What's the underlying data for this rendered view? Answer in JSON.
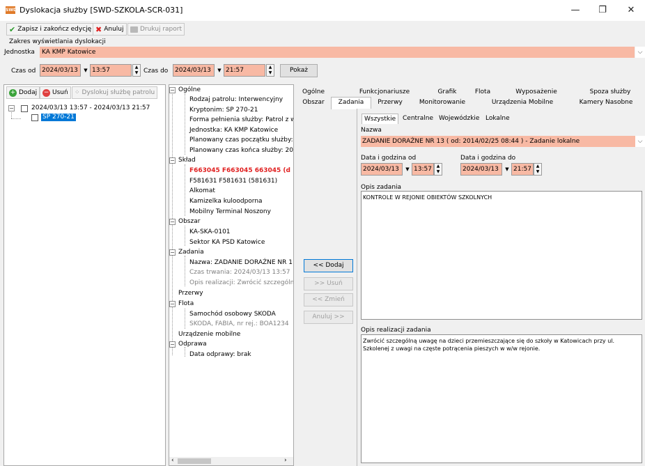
{
  "window": {
    "icon_text": "SWD",
    "title": "Dyslokacja służby [SWD-SZKOLA-SCR-031]",
    "minimize": "—",
    "maximize": "❐",
    "close": "✕"
  },
  "toolbar": {
    "save_label": "Zapisz i zakończ edycję",
    "cancel_label": "Anuluj",
    "print_label": "Drukuj raport"
  },
  "range": {
    "group_label": "Zakres wyświetlania dyslokacji",
    "unit_label": "Jednostka",
    "unit_value": "KA KMP Katowice",
    "from_label": "Czas od",
    "from_date": "2024/03/13",
    "from_time": "13:57",
    "to_label": "Czas do",
    "to_date": "2024/03/13",
    "to_time": "21:57",
    "show_button": "Pokaż"
  },
  "left": {
    "add_label": "Dodaj",
    "remove_label": "Usuń",
    "dislocate_label": "Dyslokuj służbę patrolu",
    "root_label": "2024/03/13 13:57 - 2024/03/13 21:57",
    "child_label": "SP 270-21"
  },
  "details": {
    "ogolne": "Ogólne",
    "rodzaj": "Rodzaj patrolu: Interwencyjny",
    "kryptonim": "Kryptonim: SP 270-21",
    "forma": "Forma pełnienia służby: Patrol z w",
    "jednostka": "Jednostka: KA KMP Katowice",
    "plan_start": "Planowany czas początku służby:",
    "plan_end": "Planowany czas końca służby: 20",
    "sklad": "Skład",
    "officer1": "F663045 F663045 663045 (d",
    "officer2": "F581631 F581631 (581631)",
    "alkomat": "Alkomat",
    "kamizelka": "Kamizelka kuloodporna",
    "terminal": "Mobilny Terminal Noszony",
    "obszar": "Obszar",
    "obszar1": "KA-SKA-0101",
    "obszar2": "Sektor KA PSD Katowice",
    "zadania": "Zadania",
    "zad_nazwa": "Nazwa: ZADANIE DORAŹNE NR 1",
    "zad_czas": "Czas trwania: 2024/03/13 13:57",
    "zad_opis": "Opis realizacji: Zwrócić szczególną",
    "przerwy": "Przerwy",
    "flota": "Flota",
    "flota1": "Samochód osobowy SKODA",
    "flota2": "SKODA, FABIA, nr rej.: BOA1234",
    "urzadzenie": "Urządzenie mobilne",
    "odprawa": "Odprawa",
    "odprawa1": "Data odprawy: brak"
  },
  "actions": {
    "add": "<< Dodaj",
    "remove": ">> Usuń",
    "change": "<< Zmień",
    "cancel": "Anuluj >>"
  },
  "tabs": {
    "row1": [
      "Ogólne",
      "Funkcjonariusze",
      "Grafik",
      "Flota",
      "Wyposażenie",
      "Spoza służby"
    ],
    "row2": [
      "Obszar",
      "Zadania",
      "Przerwy",
      "Monitorowanie",
      "Urządzenia Mobilne",
      "Kamery Nasobne"
    ],
    "sub": [
      "Wszystkie",
      "Centralne",
      "Wojewódzkie",
      "Lokalne"
    ]
  },
  "task": {
    "name_label": "Nazwa",
    "name_value": "ZADANIE DORAŹNE NR 13 ( od: 2014/02/25 08:44 ) - Zadanie lokalne",
    "from_label": "Data i godzina od",
    "from_date": "2024/03/13",
    "from_time": "13:57",
    "to_label": "Data i godzina do",
    "to_date": "2024/03/13",
    "to_time": "21:57",
    "desc_label": "Opis zadania",
    "desc_value": "KONTROLE W REJONIE OBIEKTÓW SZKOLNYCH",
    "real_label": "Opis realizacji zadania",
    "real_value": "Zwrócić szczególną uwagę na dzieci przemieszczające się do szkoły w Katowicach przy ul. Szkolenej z uwagi na częste potrącenia pieszych w w/w rejonie."
  },
  "colors": {
    "required_field": "#f8b9a4",
    "selection": "#0078d7",
    "alert_text": "#e02020"
  }
}
